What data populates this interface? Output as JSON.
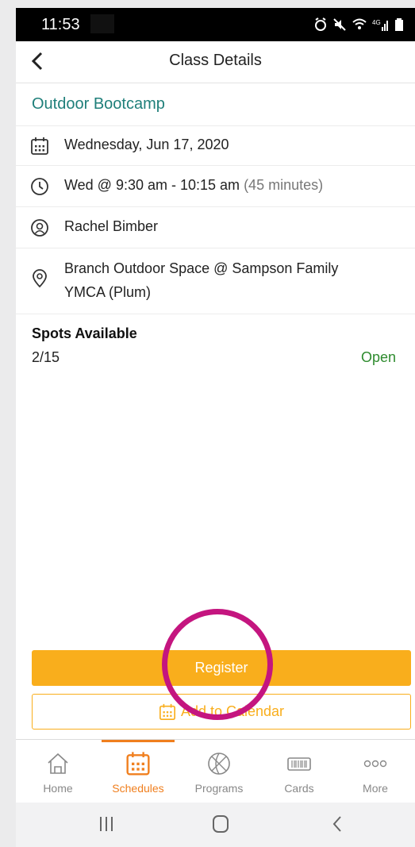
{
  "status_bar": {
    "time": "11:53"
  },
  "header": {
    "title": "Class Details"
  },
  "class": {
    "name": "Outdoor Bootcamp",
    "date": "Wednesday, Jun 17, 2020",
    "time": "Wed @ 9:30 am - 10:15 am",
    "duration": "(45 minutes)",
    "instructor": "Rachel Bimber",
    "location_line1": "Branch Outdoor Space @ Sampson Family",
    "location_line2": "YMCA (Plum)"
  },
  "spots": {
    "label": "Spots Available",
    "value": "2/15",
    "status": "Open"
  },
  "actions": {
    "register_label": "Register",
    "add_calendar_label": "Add to Calendar"
  },
  "tabs": [
    {
      "label": "Home",
      "icon": "home-icon",
      "active": false
    },
    {
      "label": "Schedules",
      "icon": "calendar-icon",
      "active": true
    },
    {
      "label": "Programs",
      "icon": "basketball-icon",
      "active": false
    },
    {
      "label": "Cards",
      "icon": "card-icon",
      "active": false
    },
    {
      "label": "More",
      "icon": "more-icon",
      "active": false
    }
  ],
  "colors": {
    "accent": "#f9ae1c",
    "active_tab": "#f07f1e",
    "title": "#1f7f7a",
    "status_open": "#2e8b2e",
    "highlight": "#c4157f"
  }
}
